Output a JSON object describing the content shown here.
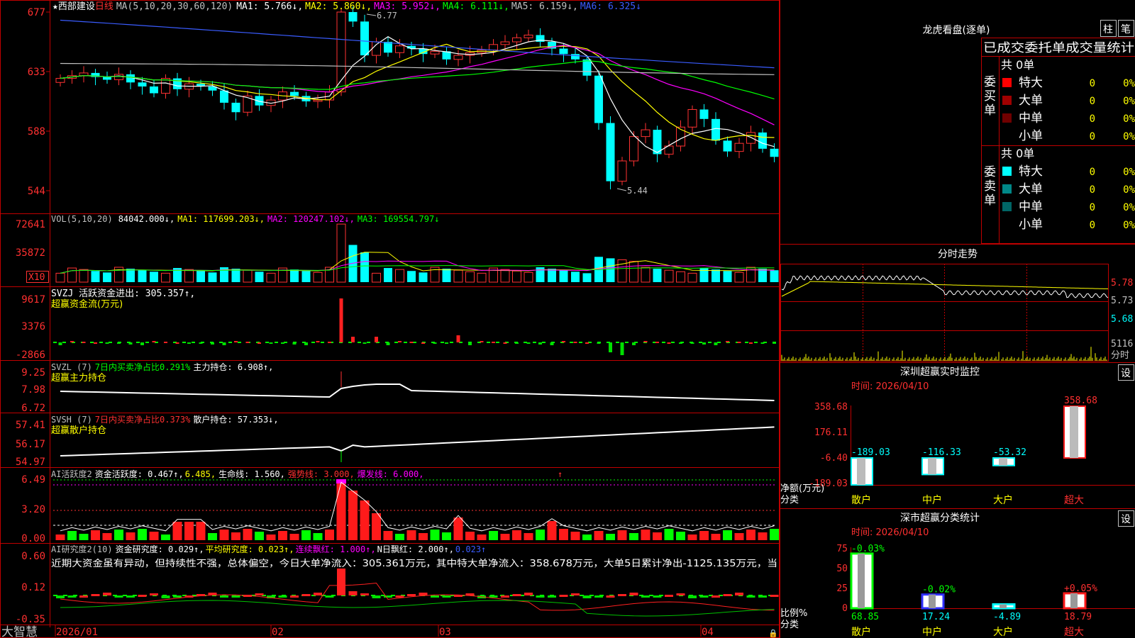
{
  "stock": {
    "star": "★",
    "name": "西部建设",
    "period": "日线"
  },
  "price_panel": {
    "ma_label": "MA(5,10,20,30,60,120)",
    "ma1": "MA1: 5.766↓,",
    "ma2": "MA2: 5.860↓,",
    "ma3": "MA3: 5.952↓,",
    "ma4": "MA4: 6.111↓,",
    "ma5": "MA5: 6.159↓,",
    "ma6": "MA6: 6.325↓",
    "high_mark": "6.77",
    "low_mark": "5.44",
    "axis": [
      "677",
      "633",
      "588",
      "544"
    ]
  },
  "vol_panel": {
    "label": "VOL(5,10,20)",
    "value": "84042.000↓,",
    "ma1": "MA1: 117699.203↓,",
    "ma2": "MA2: 120247.102↓,",
    "ma3": "MA3: 169554.797↓",
    "axis": [
      "72641",
      "35872"
    ],
    "unit": "X10"
  },
  "svzj_panel": {
    "line1": "SVZJ  活跃资金进出: 305.357↑,",
    "line2": "超赢资金流(万元)",
    "axis": [
      "9617",
      "3376",
      "-2866"
    ]
  },
  "svzl_panel": {
    "prefix": "SVZL (7)",
    "ratio": "7日内买卖净占比0.291%",
    "hold": "主力持仓: 6.908↑,",
    "line2": "超赢主力持仓",
    "axis": [
      "9.25",
      "7.98",
      "6.72"
    ]
  },
  "svsh_panel": {
    "prefix": "SVSH (7)",
    "ratio": "7日内买卖净占比0.373%",
    "hold": "散户持仓: 57.353↓,",
    "line2": "超赢散户持仓",
    "axis": [
      "57.41",
      "56.17",
      "54.97"
    ]
  },
  "ai_active": {
    "title": "AI活跃度2",
    "a": "资金活跃度: 0.467↑,",
    "b": "6.485,",
    "c": "生命线: 1.560,",
    "d": "强势线: 3.000,",
    "e": "爆发线: 6.000,",
    "arrow": "↑",
    "axis": [
      "6.49",
      "3.20",
      "0.00"
    ]
  },
  "ai_research": {
    "title": "AI研究度2(10)",
    "a": "资金研究度: 0.029↑,",
    "b": "平均研究度: 0.023↑,",
    "c": "连续飘红: 1.000↑,",
    "d": "N日飘红: 2.000↑,",
    "e": "0.023↑",
    "axis": [
      "0.60",
      "0.12",
      "-0.35"
    ],
    "commentary": "近期大资金虽有异动，但持续性不强，总体偏空，今日大单净流入：305.361万元，其中特大单净流入：358.678万元，大单5日累计净出-1125.135万元，当"
  },
  "xaxis": {
    "brand": "大智慧",
    "labels": [
      "2026/01",
      "02",
      "03",
      "04"
    ]
  },
  "longhu": {
    "title": "龙虎看盘(逐单)",
    "btn1": "柱",
    "btn2": "笔",
    "subtitle": "已成交委托单成交量统计",
    "buy_label": "委买单",
    "sell_label": "委卖单",
    "buy_total": "共 0单",
    "sell_total": "共 0单",
    "buy_rows": [
      {
        "name": "特大",
        "count": "0",
        "pct": "0%",
        "color": "#ff0000"
      },
      {
        "name": "大单",
        "count": "0",
        "pct": "0%",
        "color": "#a00000"
      },
      {
        "name": "中单",
        "count": "0",
        "pct": "0%",
        "color": "#700000"
      },
      {
        "name": "小单",
        "count": "0",
        "pct": "0%",
        "color": "#000000"
      }
    ],
    "sell_rows": [
      {
        "name": "特大",
        "count": "0",
        "pct": "0%",
        "color": "#00ffff"
      },
      {
        "name": "大单",
        "count": "0",
        "pct": "0%",
        "color": "#008888"
      },
      {
        "name": "中单",
        "count": "0",
        "pct": "0%",
        "color": "#006666"
      },
      {
        "name": "小单",
        "count": "0",
        "pct": "0%",
        "color": "#000000"
      }
    ]
  },
  "intraday": {
    "title": "分时走势",
    "prices": [
      "5.78",
      "5.73",
      "5.68"
    ],
    "vol": "5116",
    "vol_unit": "分时"
  },
  "sz_monitor": {
    "title": "深圳超赢实时监控",
    "btn": "设",
    "date": "时间: 2026/04/10",
    "axis": [
      "358.68",
      "176.11",
      "-6.40",
      "-189.03"
    ],
    "ylabel": "净额(万元)",
    "xlabel": "分类",
    "categories": [
      "散户",
      "中户",
      "大户",
      "超大"
    ],
    "values_text": [
      "-189.03",
      "-116.33",
      "-53.32",
      "358.68"
    ]
  },
  "sz_stats": {
    "title": "深市超赢分类统计",
    "btn": "设",
    "date": "时间: 2026/04/10",
    "axis": [
      "75",
      "50",
      "25",
      "0"
    ],
    "ylabel": "比例%",
    "xlabel": "分类",
    "categories": [
      "散户",
      "中户",
      "大户",
      "超大"
    ],
    "top_labels": [
      "-0.03%",
      "-0.02%",
      "",
      "+0.05%"
    ],
    "bottom_labels": [
      "68.85",
      "17.24",
      "-4.89",
      "18.79"
    ]
  },
  "chart_data": [
    {
      "type": "bar",
      "title": "深圳超赢实时监控",
      "categories": [
        "散户",
        "中户",
        "大户",
        "超大"
      ],
      "values": [
        -189.03,
        -116.33,
        -53.32,
        358.68
      ],
      "ylabel": "净额(万元)",
      "xlabel": "分类",
      "ylim": [
        -189.03,
        358.68
      ]
    },
    {
      "type": "bar",
      "title": "深市超赢分类统计",
      "categories": [
        "散户",
        "中户",
        "大户",
        "超大"
      ],
      "values": [
        68.85,
        17.24,
        4.89,
        18.79
      ],
      "ylabel": "比例%",
      "xlabel": "分类",
      "ylim": [
        0,
        75
      ]
    }
  ]
}
